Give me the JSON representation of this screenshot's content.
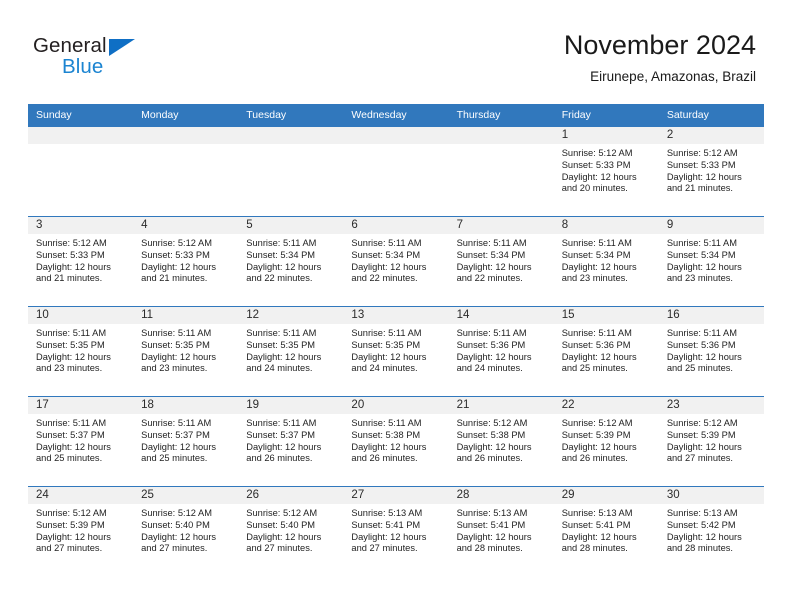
{
  "brand": {
    "name_top": "General",
    "name_bottom": "Blue",
    "accent_color": "#1b84d1",
    "logo_icon": "triangle-icon"
  },
  "header": {
    "month_year": "November 2024",
    "location": "Eirunepe, Amazonas, Brazil"
  },
  "theme": {
    "header_blue": "#3178bd",
    "daynum_band": "#f1f1f1",
    "text": "#1a1a1a"
  },
  "weekday_headers": [
    "Sunday",
    "Monday",
    "Tuesday",
    "Wednesday",
    "Thursday",
    "Friday",
    "Saturday"
  ],
  "weeks": [
    [
      {
        "day": "",
        "lines": []
      },
      {
        "day": "",
        "lines": []
      },
      {
        "day": "",
        "lines": []
      },
      {
        "day": "",
        "lines": []
      },
      {
        "day": "",
        "lines": []
      },
      {
        "day": "1",
        "lines": [
          "Sunrise: 5:12 AM",
          "Sunset: 5:33 PM",
          "Daylight: 12 hours",
          "and 20 minutes."
        ]
      },
      {
        "day": "2",
        "lines": [
          "Sunrise: 5:12 AM",
          "Sunset: 5:33 PM",
          "Daylight: 12 hours",
          "and 21 minutes."
        ]
      }
    ],
    [
      {
        "day": "3",
        "lines": [
          "Sunrise: 5:12 AM",
          "Sunset: 5:33 PM",
          "Daylight: 12 hours",
          "and 21 minutes."
        ]
      },
      {
        "day": "4",
        "lines": [
          "Sunrise: 5:12 AM",
          "Sunset: 5:33 PM",
          "Daylight: 12 hours",
          "and 21 minutes."
        ]
      },
      {
        "day": "5",
        "lines": [
          "Sunrise: 5:11 AM",
          "Sunset: 5:34 PM",
          "Daylight: 12 hours",
          "and 22 minutes."
        ]
      },
      {
        "day": "6",
        "lines": [
          "Sunrise: 5:11 AM",
          "Sunset: 5:34 PM",
          "Daylight: 12 hours",
          "and 22 minutes."
        ]
      },
      {
        "day": "7",
        "lines": [
          "Sunrise: 5:11 AM",
          "Sunset: 5:34 PM",
          "Daylight: 12 hours",
          "and 22 minutes."
        ]
      },
      {
        "day": "8",
        "lines": [
          "Sunrise: 5:11 AM",
          "Sunset: 5:34 PM",
          "Daylight: 12 hours",
          "and 23 minutes."
        ]
      },
      {
        "day": "9",
        "lines": [
          "Sunrise: 5:11 AM",
          "Sunset: 5:34 PM",
          "Daylight: 12 hours",
          "and 23 minutes."
        ]
      }
    ],
    [
      {
        "day": "10",
        "lines": [
          "Sunrise: 5:11 AM",
          "Sunset: 5:35 PM",
          "Daylight: 12 hours",
          "and 23 minutes."
        ]
      },
      {
        "day": "11",
        "lines": [
          "Sunrise: 5:11 AM",
          "Sunset: 5:35 PM",
          "Daylight: 12 hours",
          "and 23 minutes."
        ]
      },
      {
        "day": "12",
        "lines": [
          "Sunrise: 5:11 AM",
          "Sunset: 5:35 PM",
          "Daylight: 12 hours",
          "and 24 minutes."
        ]
      },
      {
        "day": "13",
        "lines": [
          "Sunrise: 5:11 AM",
          "Sunset: 5:35 PM",
          "Daylight: 12 hours",
          "and 24 minutes."
        ]
      },
      {
        "day": "14",
        "lines": [
          "Sunrise: 5:11 AM",
          "Sunset: 5:36 PM",
          "Daylight: 12 hours",
          "and 24 minutes."
        ]
      },
      {
        "day": "15",
        "lines": [
          "Sunrise: 5:11 AM",
          "Sunset: 5:36 PM",
          "Daylight: 12 hours",
          "and 25 minutes."
        ]
      },
      {
        "day": "16",
        "lines": [
          "Sunrise: 5:11 AM",
          "Sunset: 5:36 PM",
          "Daylight: 12 hours",
          "and 25 minutes."
        ]
      }
    ],
    [
      {
        "day": "17",
        "lines": [
          "Sunrise: 5:11 AM",
          "Sunset: 5:37 PM",
          "Daylight: 12 hours",
          "and 25 minutes."
        ]
      },
      {
        "day": "18",
        "lines": [
          "Sunrise: 5:11 AM",
          "Sunset: 5:37 PM",
          "Daylight: 12 hours",
          "and 25 minutes."
        ]
      },
      {
        "day": "19",
        "lines": [
          "Sunrise: 5:11 AM",
          "Sunset: 5:37 PM",
          "Daylight: 12 hours",
          "and 26 minutes."
        ]
      },
      {
        "day": "20",
        "lines": [
          "Sunrise: 5:11 AM",
          "Sunset: 5:38 PM",
          "Daylight: 12 hours",
          "and 26 minutes."
        ]
      },
      {
        "day": "21",
        "lines": [
          "Sunrise: 5:12 AM",
          "Sunset: 5:38 PM",
          "Daylight: 12 hours",
          "and 26 minutes."
        ]
      },
      {
        "day": "22",
        "lines": [
          "Sunrise: 5:12 AM",
          "Sunset: 5:39 PM",
          "Daylight: 12 hours",
          "and 26 minutes."
        ]
      },
      {
        "day": "23",
        "lines": [
          "Sunrise: 5:12 AM",
          "Sunset: 5:39 PM",
          "Daylight: 12 hours",
          "and 27 minutes."
        ]
      }
    ],
    [
      {
        "day": "24",
        "lines": [
          "Sunrise: 5:12 AM",
          "Sunset: 5:39 PM",
          "Daylight: 12 hours",
          "and 27 minutes."
        ]
      },
      {
        "day": "25",
        "lines": [
          "Sunrise: 5:12 AM",
          "Sunset: 5:40 PM",
          "Daylight: 12 hours",
          "and 27 minutes."
        ]
      },
      {
        "day": "26",
        "lines": [
          "Sunrise: 5:12 AM",
          "Sunset: 5:40 PM",
          "Daylight: 12 hours",
          "and 27 minutes."
        ]
      },
      {
        "day": "27",
        "lines": [
          "Sunrise: 5:13 AM",
          "Sunset: 5:41 PM",
          "Daylight: 12 hours",
          "and 27 minutes."
        ]
      },
      {
        "day": "28",
        "lines": [
          "Sunrise: 5:13 AM",
          "Sunset: 5:41 PM",
          "Daylight: 12 hours",
          "and 28 minutes."
        ]
      },
      {
        "day": "29",
        "lines": [
          "Sunrise: 5:13 AM",
          "Sunset: 5:41 PM",
          "Daylight: 12 hours",
          "and 28 minutes."
        ]
      },
      {
        "day": "30",
        "lines": [
          "Sunrise: 5:13 AM",
          "Sunset: 5:42 PM",
          "Daylight: 12 hours",
          "and 28 minutes."
        ]
      }
    ]
  ]
}
